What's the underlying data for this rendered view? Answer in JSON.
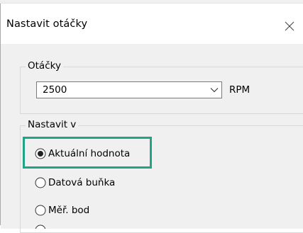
{
  "dialog": {
    "title": "Nastavit otáčky"
  },
  "rpm_group": {
    "legend": "Otáčky",
    "select_value": "2500",
    "unit": "RPM"
  },
  "set_group": {
    "legend": "Nastavit v",
    "options": [
      {
        "label": "Aktuální hodnota",
        "selected": true
      },
      {
        "label": "Datová buňka",
        "selected": false
      },
      {
        "label": "Měř. bod",
        "selected": false
      }
    ]
  },
  "colors": {
    "highlight": "#20a387",
    "panel_background": "#f0f0f0"
  },
  "icons": {
    "close": "close-icon",
    "dropdown": "chevron-down-icon"
  }
}
